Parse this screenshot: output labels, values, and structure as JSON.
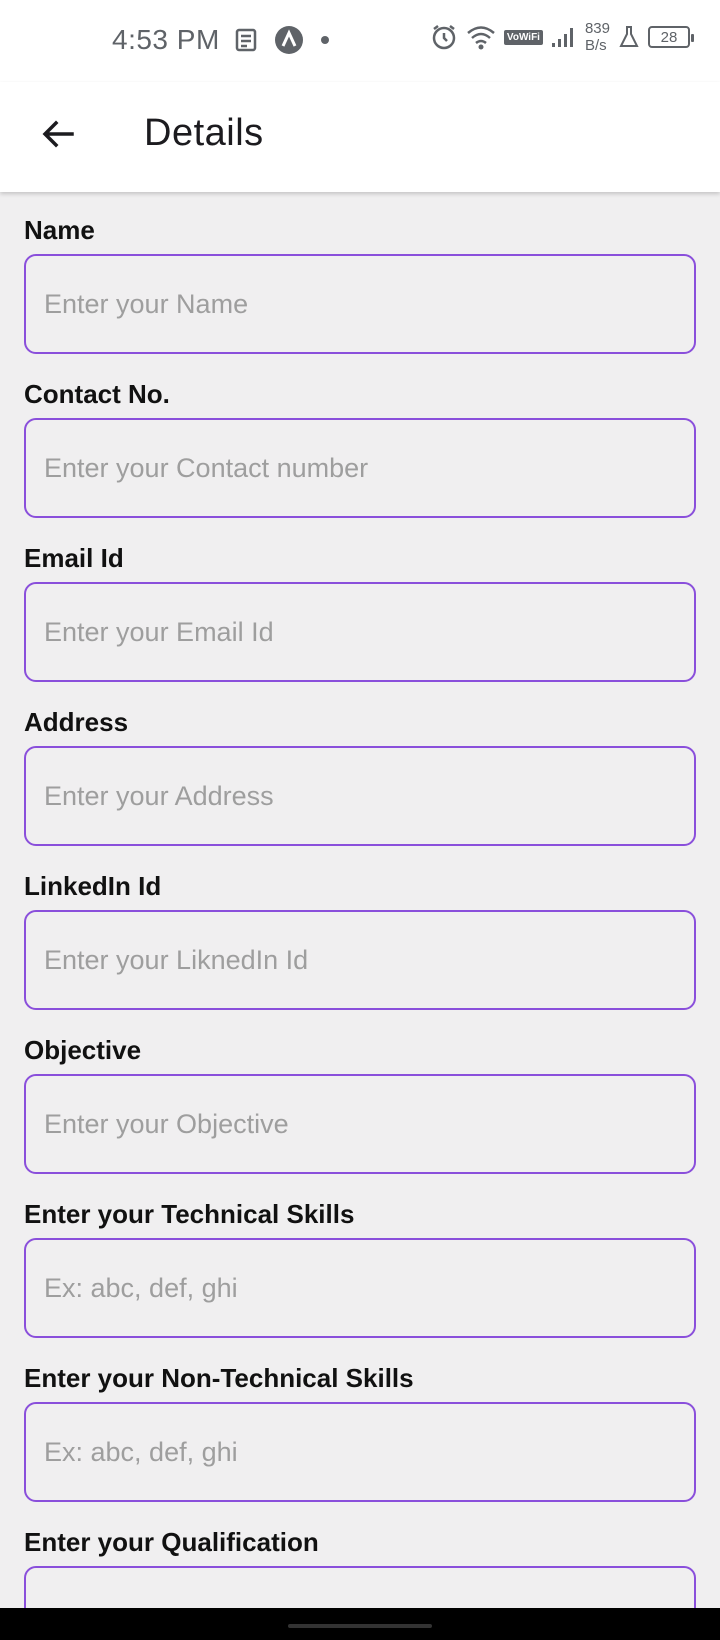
{
  "status_bar": {
    "time": "4:53 PM",
    "net_speed_value": "839",
    "net_speed_unit": "B/s",
    "vowifi": "VoWiFi",
    "battery": "28"
  },
  "app_bar": {
    "title": "Details",
    "back_icon": "arrow-back-icon"
  },
  "form": {
    "fields": [
      {
        "label": "Name",
        "placeholder": "Enter your Name"
      },
      {
        "label": "Contact No.",
        "placeholder": "Enter your Contact number"
      },
      {
        "label": "Email Id",
        "placeholder": "Enter your Email Id"
      },
      {
        "label": "Address",
        "placeholder": "Enter your Address"
      },
      {
        "label": "LinkedIn Id",
        "placeholder": "Enter your LiknedIn Id"
      },
      {
        "label": "Objective",
        "placeholder": "Enter your Objective"
      },
      {
        "label": "Enter your Technical Skills",
        "placeholder": "Ex: abc, def, ghi"
      },
      {
        "label": "Enter your Non-Technical Skills",
        "placeholder": "Ex: abc, def, ghi"
      },
      {
        "label": "Enter your Qualification",
        "placeholder": ""
      }
    ]
  },
  "colors": {
    "accent_border": "#8a4fdb",
    "background": "#f0eff0",
    "surface": "#ffffff"
  }
}
